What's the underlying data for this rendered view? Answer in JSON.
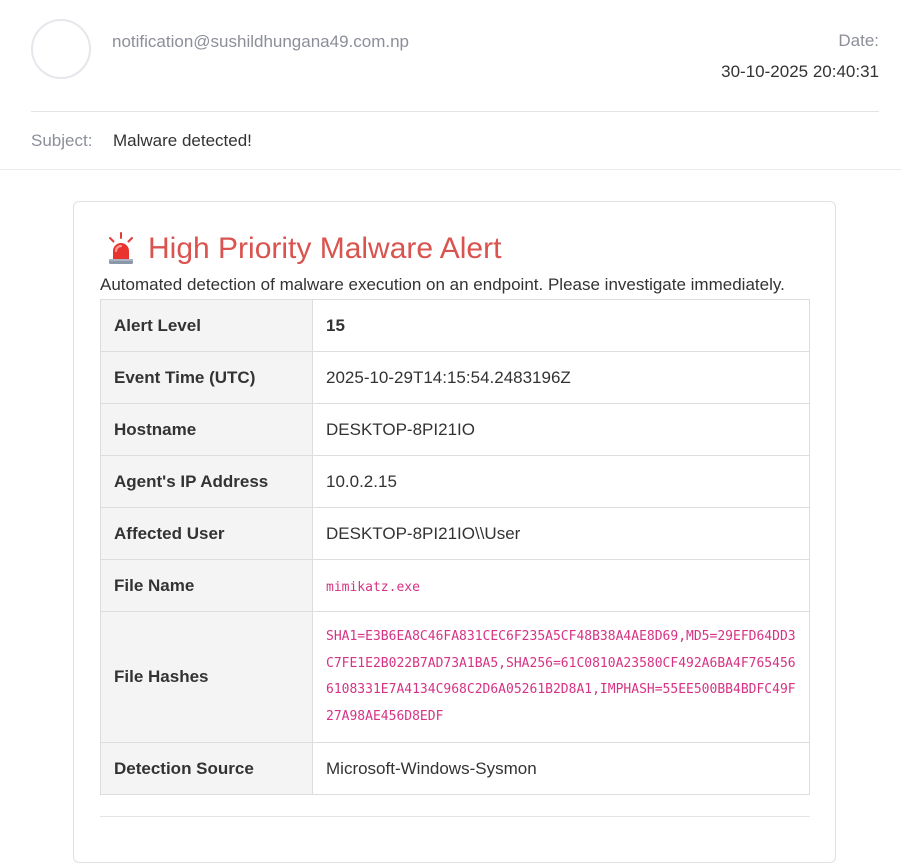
{
  "header": {
    "sender": "notification@sushildhungana49.com.np",
    "date_label": "Date:",
    "date_value": "30-10-2025 20:40:31",
    "subject_label": "Subject:",
    "subject_value": "Malware detected!"
  },
  "alert": {
    "icon": "siren-icon",
    "title": "High Priority Malware Alert",
    "description": "Automated detection of malware execution on an endpoint. Please investigate immediately.",
    "title_color": "#d9534f",
    "code_color": "#d63384"
  },
  "rows": [
    {
      "label": "Alert Level",
      "value": "15"
    },
    {
      "label": "Event Time (UTC)",
      "value": "2025-10-29T14:15:54.2483196Z"
    },
    {
      "label": "Hostname",
      "value": "DESKTOP-8PI21IO"
    },
    {
      "label": "Agent's IP Address",
      "value": "10.0.2.15"
    },
    {
      "label": "Affected User",
      "value": "DESKTOP-8PI21IO\\\\User"
    },
    {
      "label": "File Name",
      "value": "mimikatz.exe"
    },
    {
      "label": "File Hashes",
      "value": "SHA1=E3B6EA8C46FA831CEC6F235A5CF48B38A4AE8D69,MD5=29EFD64DD3C7FE1E2B022B7AD73A1BA5,SHA256=61C0810A23580CF492A6BA4F7654566108331E7A4134C968C2D6A05261B2D8A1,IMPHASH=55EE500BB4BDFC49F27A98AE456D8EDF"
    },
    {
      "label": "Detection Source",
      "value": "Microsoft-Windows-Sysmon"
    }
  ]
}
